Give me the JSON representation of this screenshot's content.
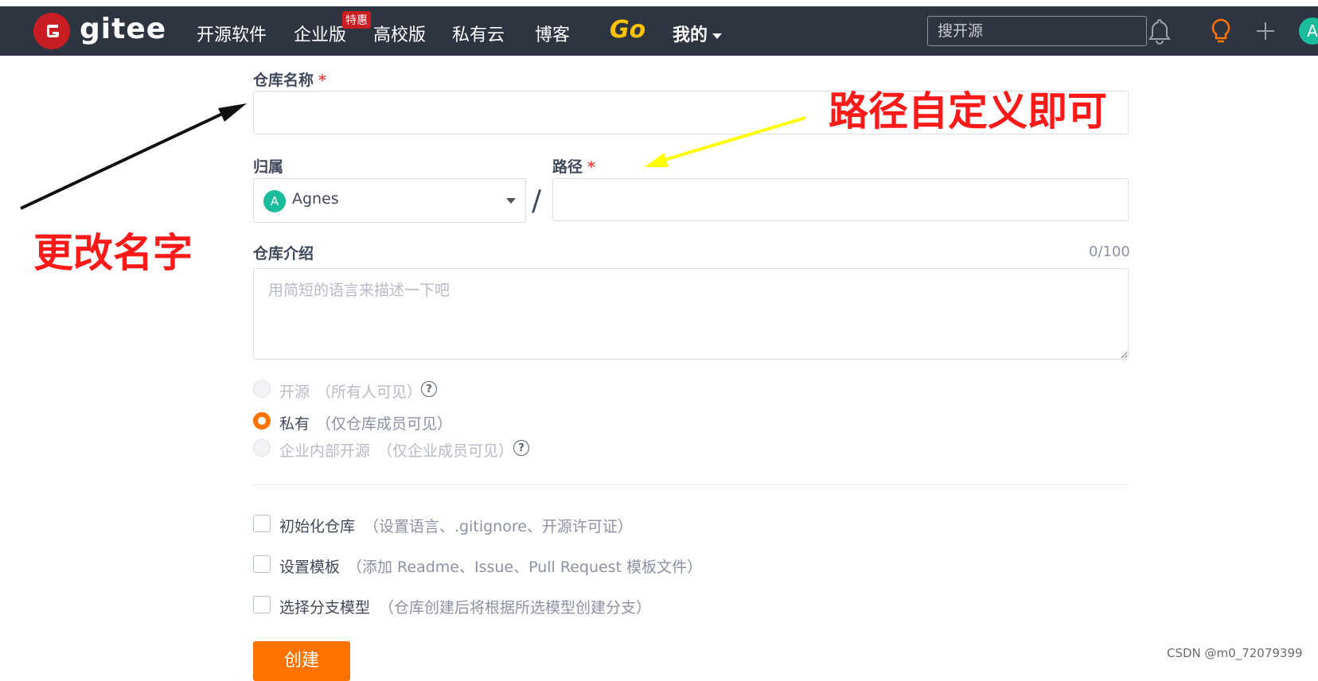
{
  "header": {
    "logo_text": "gitee",
    "nav": [
      "开源软件",
      "企业版",
      "高校版",
      "私有云",
      "博客"
    ],
    "badge": "特惠",
    "go_label": "Go",
    "mine_label": "我的",
    "search_placeholder": "搜开源",
    "avatar_letter": "A",
    "colors": {
      "bar": "#2f3441",
      "logo": "#c71d23",
      "go": "#ffc200"
    },
    "icons": [
      "bell-icon",
      "bulb-icon",
      "plus-icon"
    ]
  },
  "form": {
    "repo_name_label": "仓库名称",
    "required_mark": "*",
    "owner_label": "归属",
    "owner_avatar": "A",
    "owner_value": "Agnes",
    "slash": "/",
    "path_label": "路径",
    "intro_label": "仓库介绍",
    "intro_counter": "0/100",
    "intro_placeholder": "用简短的语言来描述一下吧",
    "visibility": [
      {
        "label": "开源",
        "note": "（所有人可见）",
        "state": "disabled",
        "help": true
      },
      {
        "label": "私有",
        "note": "（仅仓库成员可见）",
        "state": "selected",
        "help": false
      },
      {
        "label": "企业内部开源",
        "note": "（仅企业成员可见）",
        "state": "disabled",
        "help": true
      }
    ],
    "options": [
      {
        "label": "初始化仓库",
        "note": "（设置语言、.gitignore、开源许可证）"
      },
      {
        "label": "设置模板",
        "note": "（添加 Readme、Issue、Pull Request 模板文件）"
      },
      {
        "label": "选择分支模型",
        "note": "（仓库创建后将根据所选模型创建分支）"
      }
    ],
    "create_button": "创建",
    "accent": "#fe7300"
  },
  "annotations": {
    "rename": "更改名字",
    "path_custom": "路径自定义即可"
  },
  "watermark": "CSDN @m0_72079399"
}
